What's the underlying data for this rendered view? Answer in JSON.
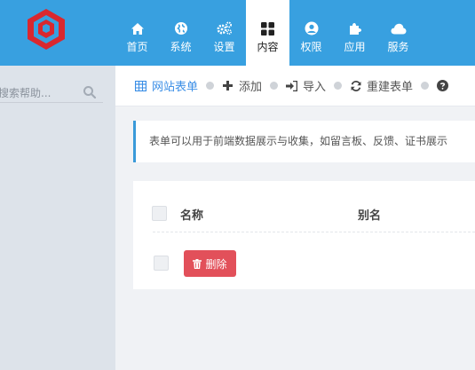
{
  "nav": [
    {
      "label": "首页",
      "icon": "home-icon"
    },
    {
      "label": "系统",
      "icon": "globe-icon"
    },
    {
      "label": "设置",
      "icon": "gears-icon"
    },
    {
      "label": "内容",
      "icon": "grid-icon",
      "active": true
    },
    {
      "label": "权限",
      "icon": "user-circle-icon"
    },
    {
      "label": "应用",
      "icon": "puzzle-icon"
    },
    {
      "label": "服务",
      "icon": "cloud-icon"
    }
  ],
  "sidebar": {
    "search_placeholder": "搜索帮助..."
  },
  "tabs": [
    {
      "label": "网站表单",
      "icon": "table-icon",
      "active": true
    },
    {
      "label": "添加",
      "icon": "plus-icon"
    },
    {
      "label": "导入",
      "icon": "sign-in-icon"
    },
    {
      "label": "重建表单",
      "icon": "refresh-icon"
    }
  ],
  "notice": "表单可以用于前端数据展示与收集，如留言板、反馈、证书展示",
  "table": {
    "columns": [
      "名称",
      "别名"
    ],
    "delete_label": "删除"
  },
  "colors": {
    "topbar": "#38a0e0",
    "active_tab": "#3a8ee6",
    "danger": "#e2505a",
    "logo": "#d9282f"
  }
}
